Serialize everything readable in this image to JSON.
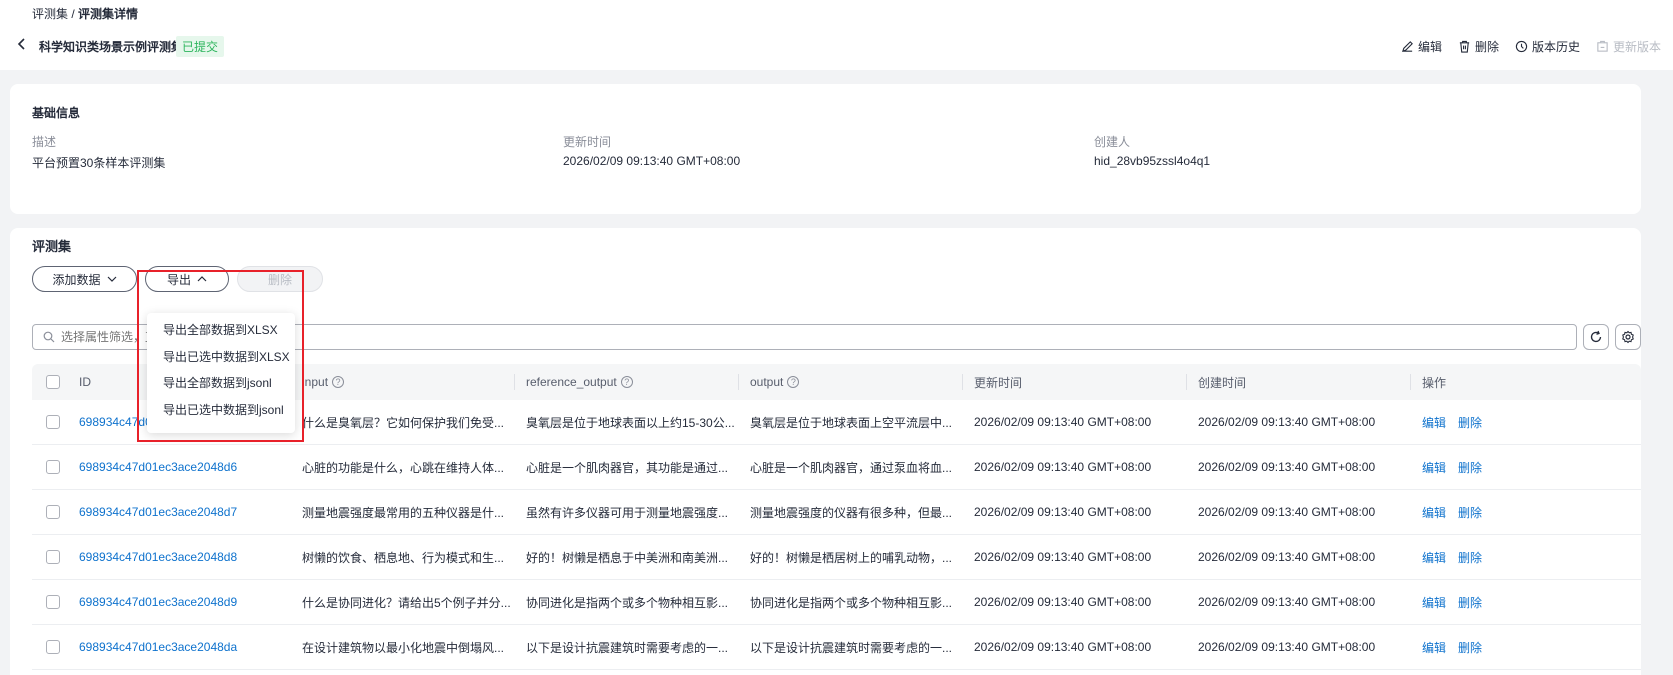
{
  "breadcrumb": {
    "parent": "评测集",
    "separator": "/",
    "current": "评测集详情"
  },
  "header": {
    "title": "科学知识类场景示例评测集",
    "status": "已提交",
    "actions": {
      "edit": "编辑",
      "delete": "删除",
      "history": "版本历史",
      "update_version": "更新版本"
    }
  },
  "basic_info": {
    "section_title": "基础信息",
    "description_label": "描述",
    "description_value": "平台预置30条样本评测集",
    "updated_label": "更新时间",
    "updated_value": "2026/02/09 09:13:40 GMT+08:00",
    "creator_label": "创建人",
    "creator_value": "hid_28vb95zssl4o4q1"
  },
  "dataset": {
    "section_title": "评测集",
    "add_data_label": "添加数据",
    "export_label": "导出",
    "delete_label": "删除",
    "search_placeholder": "选择属性筛选，直",
    "export_menu": [
      "导出全部数据到XLSX",
      "导出已选中数据到XLSX",
      "导出全部数据到jsonl",
      "导出已选中数据到jsonl"
    ]
  },
  "table": {
    "headers": {
      "id": "ID",
      "input": "input",
      "reference_output": "reference_output",
      "output": "output",
      "updated": "更新时间",
      "created": "创建时间",
      "ops": "操作"
    },
    "op_edit": "编辑",
    "op_delete": "删除",
    "rows": [
      {
        "id": "698934c47d01e",
        "input": "什么是臭氧层？它如何保护我们免受...",
        "reference_output": "臭氧层是位于地球表面以上约15-30公...",
        "output": "臭氧层是位于地球表面上空平流层中...",
        "updated": "2026/02/09 09:13:40 GMT+08:00",
        "created": "2026/02/09 09:13:40 GMT+08:00"
      },
      {
        "id": "698934c47d01ec3ace2048d6",
        "input": "心脏的功能是什么，心跳在维持人体...",
        "reference_output": "心脏是一个肌肉器官，其功能是通过...",
        "output": "心脏是一个肌肉器官，通过泵血将血...",
        "updated": "2026/02/09 09:13:40 GMT+08:00",
        "created": "2026/02/09 09:13:40 GMT+08:00"
      },
      {
        "id": "698934c47d01ec3ace2048d7",
        "input": "测量地震强度最常用的五种仪器是什...",
        "reference_output": "虽然有许多仪器可用于测量地震强度...",
        "output": "测量地震强度的仪器有很多种，但最...",
        "updated": "2026/02/09 09:13:40 GMT+08:00",
        "created": "2026/02/09 09:13:40 GMT+08:00"
      },
      {
        "id": "698934c47d01ec3ace2048d8",
        "input": "树懒的饮食、栖息地、行为模式和生...",
        "reference_output": "好的！树懒是栖息于中美洲和南美洲...",
        "output": "好的！树懒是栖居树上的哺乳动物，...",
        "updated": "2026/02/09 09:13:40 GMT+08:00",
        "created": "2026/02/09 09:13:40 GMT+08:00"
      },
      {
        "id": "698934c47d01ec3ace2048d9",
        "input": "什么是协同进化？请给出5个例子并分...",
        "reference_output": "协同进化是指两个或多个物种相互影...",
        "output": "协同进化是指两个或多个物种相互影...",
        "updated": "2026/02/09 09:13:40 GMT+08:00",
        "created": "2026/02/09 09:13:40 GMT+08:00"
      },
      {
        "id": "698934c47d01ec3ace2048da",
        "input": "在设计建筑物以最小化地震中倒塌风...",
        "reference_output": "以下是设计抗震建筑时需要考虑的一...",
        "output": "以下是设计抗震建筑时需要考虑的一...",
        "updated": "2026/02/09 09:13:40 GMT+08:00",
        "created": "2026/02/09 09:13:40 GMT+08:00"
      }
    ]
  },
  "colors": {
    "link": "#0e72cd",
    "success_bg": "#e6f7ec",
    "success_text": "#2db55d",
    "highlight": "#e8212a"
  }
}
